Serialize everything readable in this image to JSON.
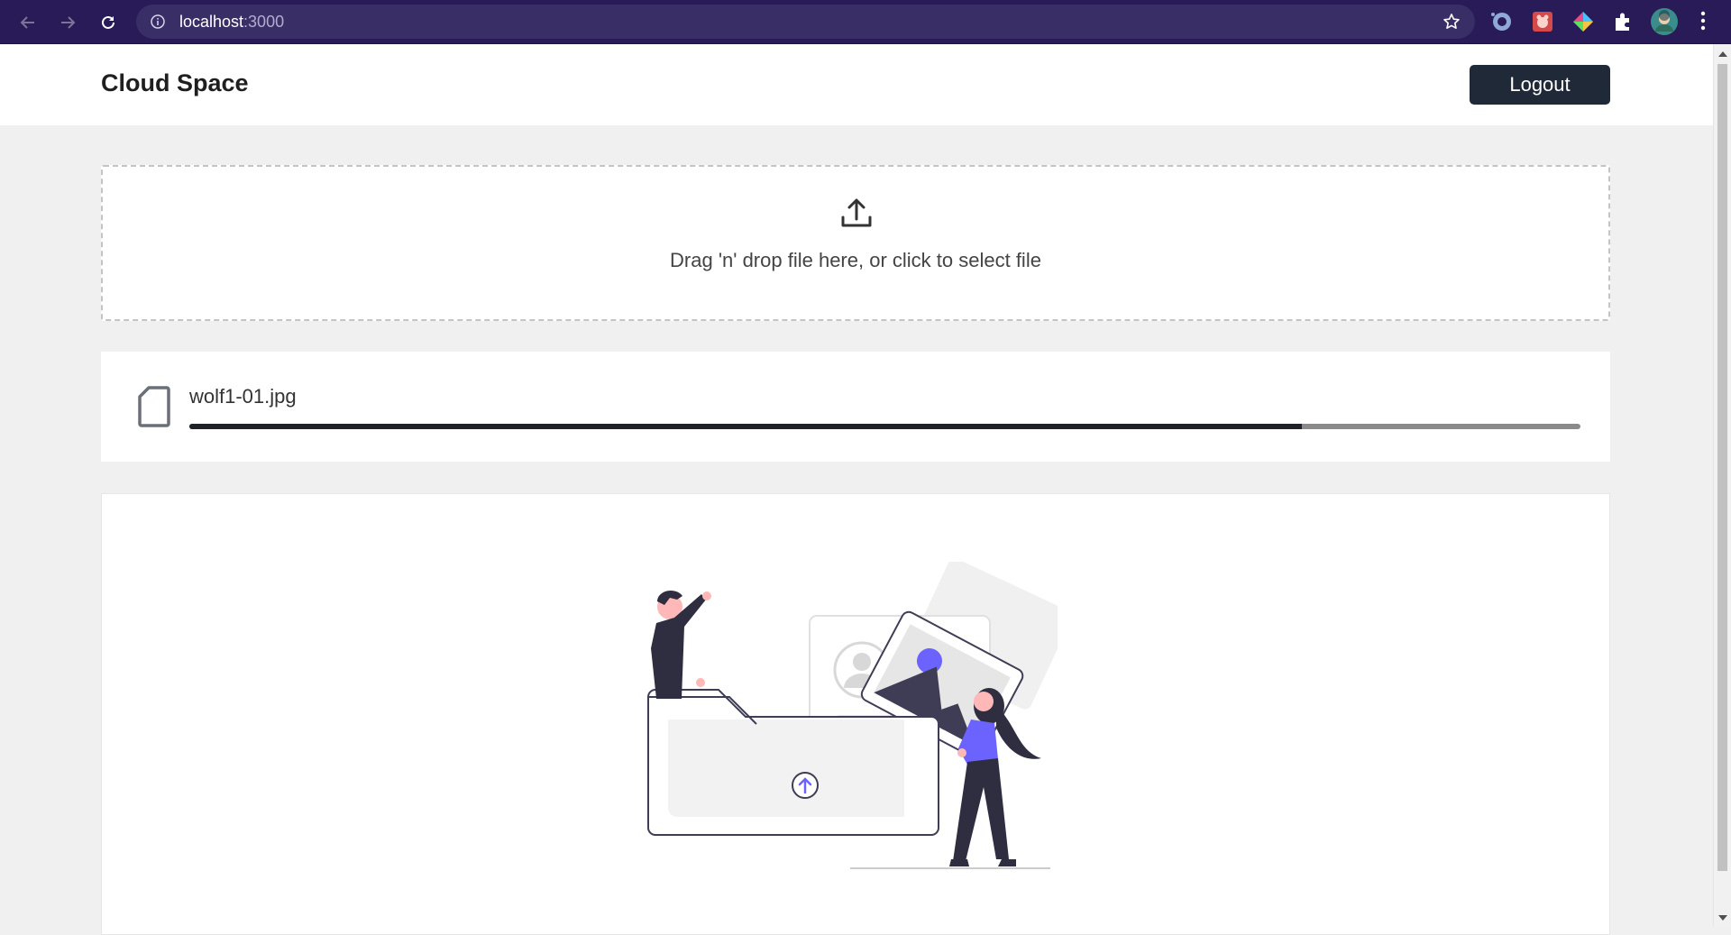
{
  "browser": {
    "url_host": "localhost",
    "url_port": ":3000"
  },
  "header": {
    "title": "Cloud Space",
    "logout_label": "Logout"
  },
  "dropzone": {
    "text": "Drag 'n' drop file here, or click to select file",
    "icon": "upload-icon"
  },
  "upload": {
    "file_name": "wolf1-01.jpg",
    "progress": 0.8,
    "icon": "file-icon"
  },
  "empty_state": {
    "illustration": "upload-illustration"
  },
  "colors": {
    "browser_bar": "#281b57",
    "primary_dark": "#1f2937",
    "accent": "#6c63ff"
  }
}
